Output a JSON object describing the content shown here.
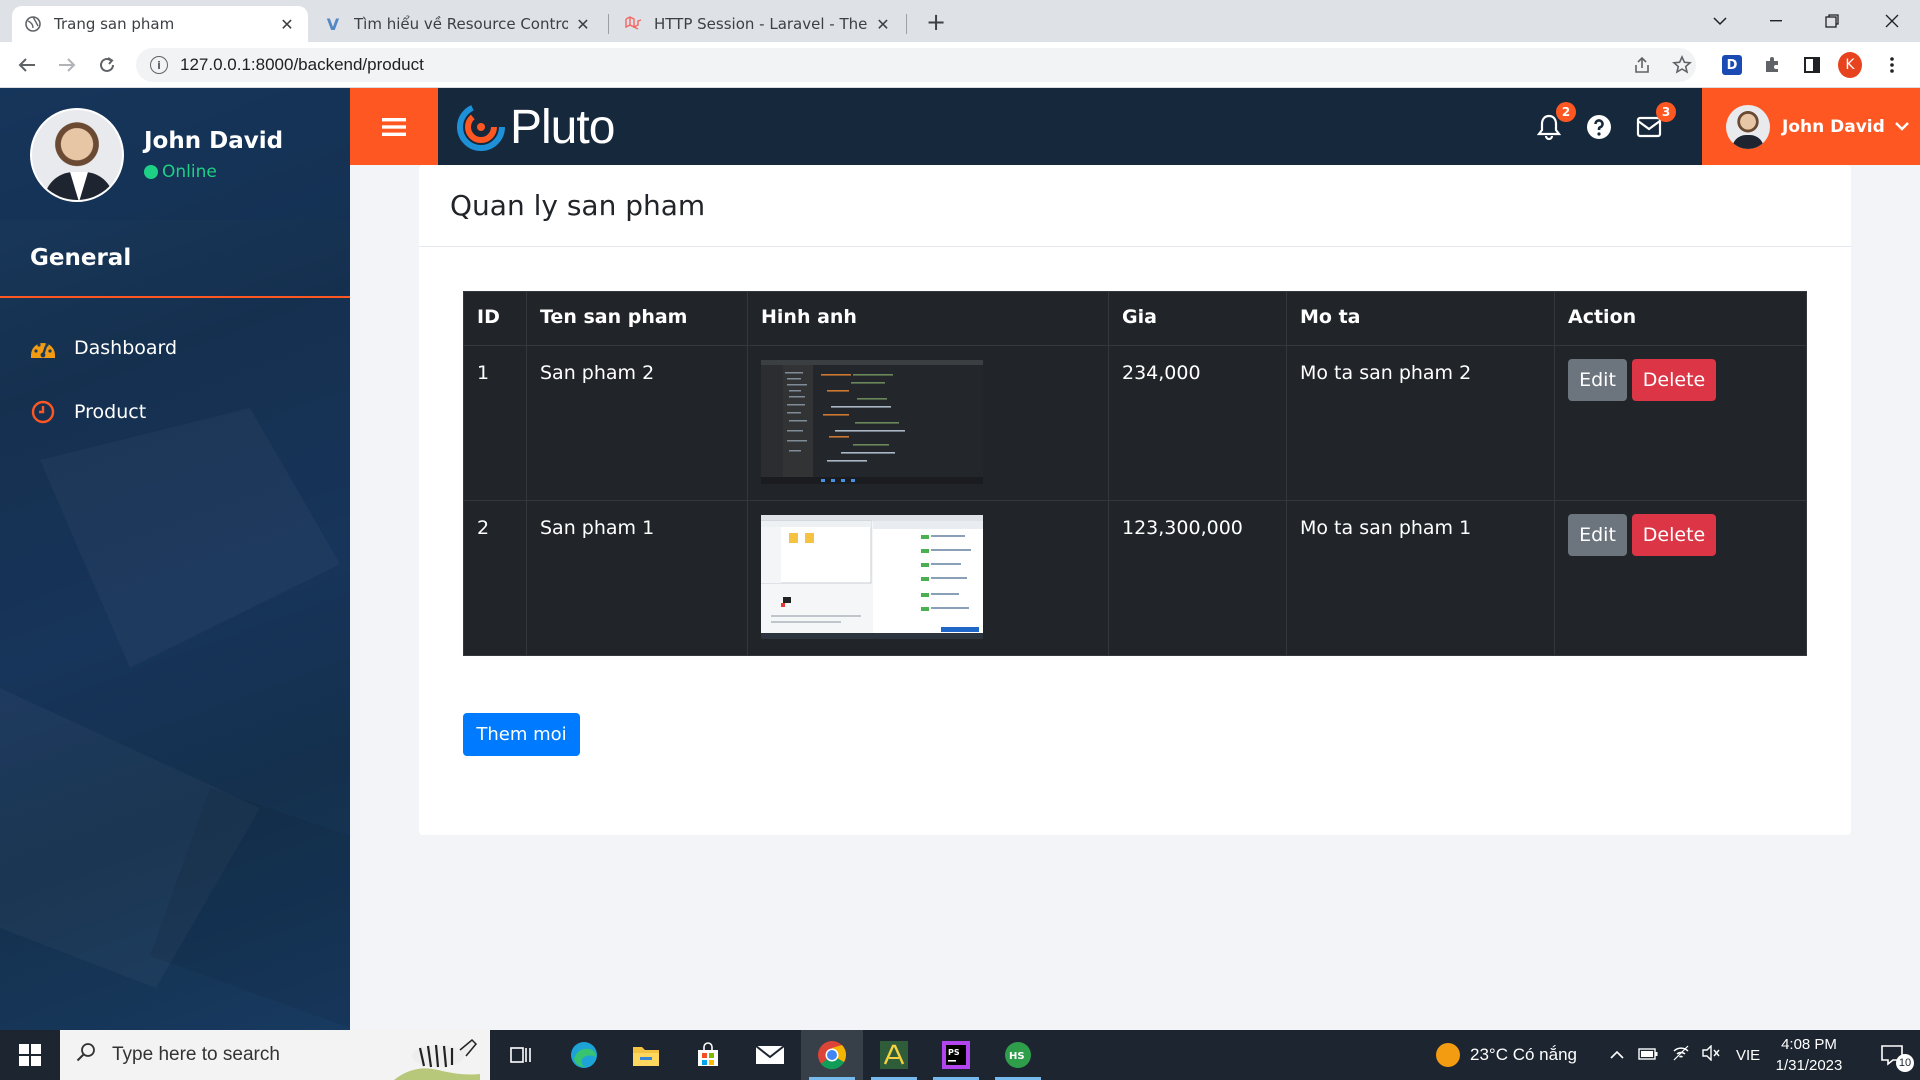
{
  "browser": {
    "tabs": [
      {
        "title": "Trang san pham",
        "active": true
      },
      {
        "title": "Tìm hiểu về Resource Controller t",
        "active": false
      },
      {
        "title": "HTTP Session - Laravel - The PHP",
        "active": false
      }
    ],
    "url": "127.0.0.1:8000/backend/product",
    "profile_initial": "K",
    "ext_letter": "D"
  },
  "sidebar": {
    "user_name": "John David",
    "status": "Online",
    "section": "General",
    "items": [
      {
        "label": "Dashboard",
        "icon": "dashboard-icon"
      },
      {
        "label": "Product",
        "icon": "clock-icon"
      }
    ]
  },
  "topbar": {
    "logo_text": "Pluto",
    "notifications_count": "2",
    "messages_count": "3",
    "user_name": "John David"
  },
  "main": {
    "title": "Quan ly san pham",
    "table": {
      "headers": [
        "ID",
        "Ten san pham",
        "Hinh anh",
        "Gia",
        "Mo ta",
        "Action"
      ],
      "rows": [
        {
          "id": "1",
          "name": "San pham 2",
          "price": "234,000",
          "desc": "Mo ta san pham 2",
          "thumb": "dark"
        },
        {
          "id": "2",
          "name": "San pham 1",
          "price": "123,300,000",
          "desc": "Mo ta san pham 1",
          "thumb": "light"
        }
      ],
      "edit_label": "Edit",
      "delete_label": "Delete"
    },
    "add_button": "Them moi"
  },
  "colors": {
    "accent": "#ff5722",
    "topbar": "#15283c",
    "table_bg": "#212529",
    "primary": "#007bff",
    "danger": "#dc3545",
    "secondary": "#6c757d",
    "online": "#1ed085"
  },
  "taskbar": {
    "search_placeholder": "Type here to search",
    "weather": "23°C  Có nắng",
    "language": "VIE",
    "time": "4:08 PM",
    "date": "1/31/2023",
    "notification_count": "10"
  }
}
